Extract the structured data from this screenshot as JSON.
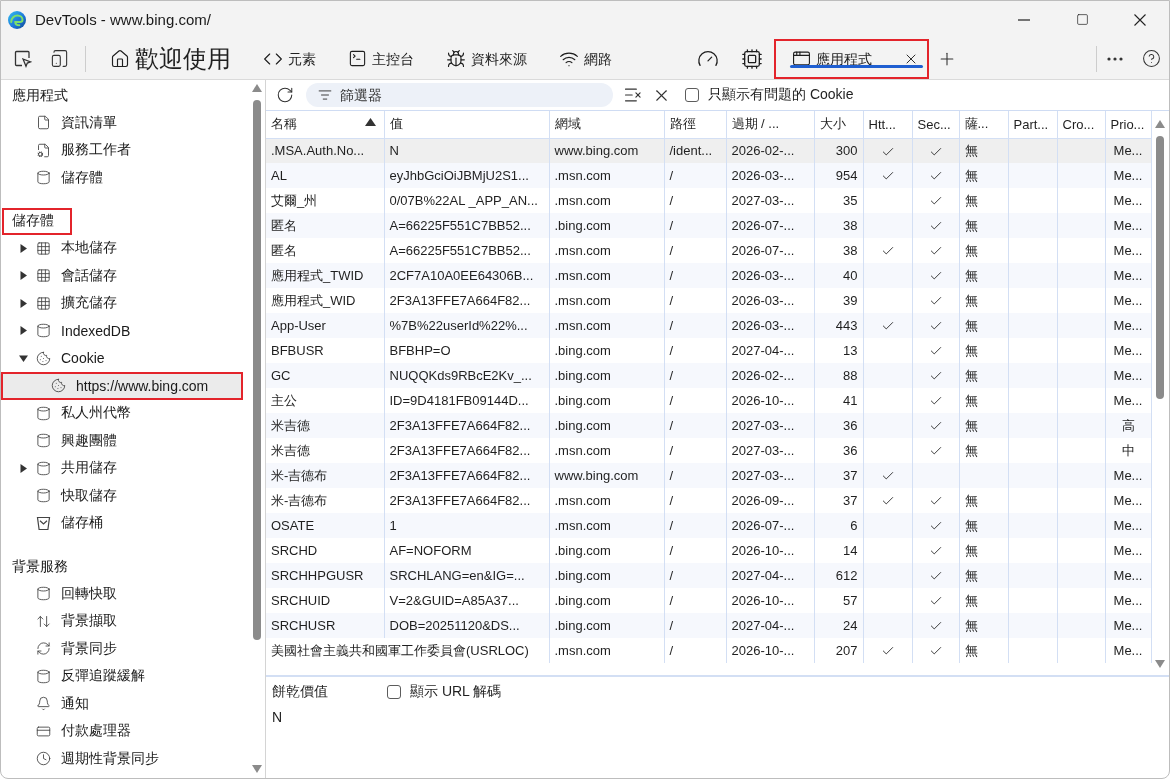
{
  "window": {
    "title": "DevTools - www.bing.com/"
  },
  "toolbar": {
    "tabs": [
      {
        "kind": "welcome",
        "label": "歡迎使用",
        "selected": false,
        "highlighted": false
      },
      {
        "kind": "elements",
        "label": "元素",
        "selected": false,
        "highlighted": false
      },
      {
        "kind": "console",
        "label": "主控台",
        "selected": false,
        "highlighted": false
      },
      {
        "kind": "sources",
        "label": "資料來源",
        "selected": false,
        "highlighted": false
      },
      {
        "kind": "network",
        "label": "網路",
        "selected": false,
        "highlighted": false
      },
      {
        "kind": "performance",
        "selected": false,
        "highlighted": false
      },
      {
        "kind": "memory",
        "selected": false,
        "highlighted": false
      },
      {
        "kind": "application",
        "label": "應用程式",
        "selected": true,
        "highlighted": true
      }
    ]
  },
  "sidebar": {
    "sections": [
      {
        "title": "應用程式",
        "highlighted": false,
        "items": [
          {
            "kind": "manifest",
            "label": "資訊清單",
            "selected": false,
            "highlighted": false
          },
          {
            "kind": "service-worker",
            "label": "服務工作者",
            "selected": false,
            "highlighted": false
          },
          {
            "kind": "database",
            "label": "儲存體",
            "selected": false,
            "highlighted": false
          }
        ]
      },
      {
        "title": "儲存體",
        "highlighted": true,
        "items": [
          {
            "kind": "table",
            "label": "本地儲存",
            "expanded": false,
            "selected": false,
            "highlighted": false
          },
          {
            "kind": "table",
            "label": "會話儲存",
            "expanded": false,
            "selected": false,
            "highlighted": false
          },
          {
            "kind": "table",
            "label": "擴充儲存",
            "expanded": false,
            "selected": false,
            "highlighted": false
          },
          {
            "kind": "database",
            "label": "IndexedDB",
            "expanded": false,
            "selected": false,
            "highlighted": false
          },
          {
            "kind": "cookie",
            "label": "Cookie",
            "expanded": true,
            "selected": false,
            "highlighted": false,
            "children": [
              {
                "kind": "cookie",
                "label": "https://www.bing.com",
                "selected": true,
                "highlighted": true
              }
            ]
          },
          {
            "kind": "database",
            "label": "私人州代幣",
            "selected": false,
            "highlighted": false
          },
          {
            "kind": "database",
            "label": "興趣團體",
            "selected": false,
            "highlighted": false
          },
          {
            "kind": "database",
            "label": "共用儲存",
            "expanded": false,
            "selected": false,
            "highlighted": false
          },
          {
            "kind": "database",
            "label": "快取儲存",
            "selected": false,
            "highlighted": false
          },
          {
            "kind": "bucket",
            "label": "儲存桶",
            "selected": false,
            "highlighted": false
          }
        ]
      },
      {
        "title": "背景服務",
        "highlighted": false,
        "items": [
          {
            "kind": "database",
            "label": "回轉快取",
            "selected": false,
            "highlighted": false
          },
          {
            "kind": "transfer",
            "label": "背景擷取",
            "selected": false,
            "highlighted": false
          },
          {
            "kind": "sync",
            "label": "背景同步",
            "selected": false,
            "highlighted": false
          },
          {
            "kind": "database",
            "label": "反彈追蹤緩解",
            "selected": false,
            "highlighted": false
          },
          {
            "kind": "bell",
            "label": "通知",
            "selected": false,
            "highlighted": false
          },
          {
            "kind": "card",
            "label": "付款處理器",
            "selected": false,
            "highlighted": false
          },
          {
            "kind": "clock",
            "label": "週期性背景同步",
            "selected": false,
            "highlighted": false
          }
        ]
      }
    ]
  },
  "cookies": {
    "filter": {
      "placeholder": "篩選器"
    },
    "only_issues": {
      "label": "只顯示有問題的 Cookie",
      "checked": false
    },
    "columns": [
      {
        "label": "名稱",
        "sorted": true
      },
      {
        "label": "值",
        "sorted": false
      },
      {
        "label": "網域",
        "sorted": false
      },
      {
        "label": "路徑",
        "sorted": false
      },
      {
        "label": "過期 / ...",
        "sorted": false
      },
      {
        "label": "大小",
        "sorted": false
      },
      {
        "label": "Htt...",
        "sorted": false
      },
      {
        "label": "Sec...",
        "sorted": false
      },
      {
        "label": "薩...",
        "sorted": false
      },
      {
        "label": "Part...",
        "sorted": false
      },
      {
        "label": "Cro...",
        "sorted": false
      },
      {
        "label": "Prio...",
        "sorted": false
      }
    ],
    "rows": [
      {
        "name": ".MSA.Auth.No...",
        "value": "N",
        "domain": "www.bing.com",
        "path": "/ident...",
        "expires": "2026-02-...",
        "size": "300",
        "http_only": true,
        "secure": true,
        "same_site": "無",
        "priority": "Me...",
        "selected": true
      },
      {
        "name": "AL",
        "value": "eyJhbGciOiJBMjU2S1...",
        "domain": ".msn.com",
        "path": "/",
        "expires": "2026-03-...",
        "size": "954",
        "http_only": true,
        "secure": true,
        "same_site": "無",
        "priority": "Me...",
        "selected": false
      },
      {
        "name": "艾爾_州",
        "value": "0/07B%22AL _APP_AN...",
        "domain": ".msn.com",
        "path": "/",
        "expires": "2027-03-...",
        "size": "35",
        "http_only": false,
        "secure": true,
        "same_site": "無",
        "priority": "Me...",
        "selected": false
      },
      {
        "name": "匿名",
        "value": "A=66225F551C7BB52...",
        "domain": ".bing.com",
        "path": "/",
        "expires": "2026-07-...",
        "size": "38",
        "http_only": false,
        "secure": true,
        "same_site": "無",
        "priority": "Me...",
        "selected": false
      },
      {
        "name": "匿名",
        "value": "A=66225F551C7BB52...",
        "domain": ".msn.com",
        "path": "/",
        "expires": "2026-07-...",
        "size": "38",
        "http_only": true,
        "secure": true,
        "same_site": "無",
        "priority": "Me...",
        "selected": false
      },
      {
        "name": "應用程式_TWID",
        "value": "2CF7A10A0EE64306B...",
        "domain": ".msn.com",
        "path": "/",
        "expires": "2026-03-...",
        "size": "40",
        "http_only": false,
        "secure": true,
        "same_site": "無",
        "priority": "Me...",
        "selected": false
      },
      {
        "name": "應用程式_WID",
        "value": "2F3A13FFE7A664F82...",
        "domain": ".msn.com",
        "path": "/",
        "expires": "2026-03-...",
        "size": "39",
        "http_only": false,
        "secure": true,
        "same_site": "無",
        "priority": "Me...",
        "selected": false
      },
      {
        "name": "App-User",
        "value": "%7B%22userId%22%...",
        "domain": ".msn.com",
        "path": "/",
        "expires": "2026-03-...",
        "size": "443",
        "http_only": true,
        "secure": true,
        "same_site": "無",
        "priority": "Me...",
        "selected": false
      },
      {
        "name": "BFBUSR",
        "value": "BFBHP=O",
        "domain": ".bing.com",
        "path": "/",
        "expires": "2027-04-...",
        "size": "13",
        "http_only": false,
        "secure": true,
        "same_site": "無",
        "priority": "Me...",
        "selected": false
      },
      {
        "name": "GC",
        "value": "NUQQKds9RBcE2Kv_...",
        "domain": ".bing.com",
        "path": "/",
        "expires": "2026-02-...",
        "size": "88",
        "http_only": false,
        "secure": true,
        "same_site": "無",
        "priority": "Me...",
        "selected": false
      },
      {
        "name": "主公",
        "value": "ID=9D4181FB09144D...",
        "domain": ".bing.com",
        "path": "/",
        "expires": "2026-10-...",
        "size": "41",
        "http_only": false,
        "secure": true,
        "same_site": "無",
        "priority": "Me...",
        "selected": false
      },
      {
        "name": "米吉德",
        "value": "2F3A13FFE7A664F82...",
        "domain": ".bing.com",
        "path": "/",
        "expires": "2027-03-...",
        "size": "36",
        "http_only": false,
        "secure": true,
        "same_site": "無",
        "priority": "高",
        "selected": false
      },
      {
        "name": "米吉德",
        "value": "2F3A13FFE7A664F82...",
        "domain": ".msn.com",
        "path": "/",
        "expires": "2027-03-...",
        "size": "36",
        "http_only": false,
        "secure": true,
        "same_site": "無",
        "priority": "中",
        "selected": false
      },
      {
        "name": "米-吉德布",
        "value": "2F3A13FFE7A664F82...",
        "domain": "www.bing.com",
        "path": "/",
        "expires": "2027-03-...",
        "size": "37",
        "http_only": true,
        "secure": false,
        "priority": "Me...",
        "selected": false
      },
      {
        "name": "米-吉德布",
        "value": "2F3A13FFE7A664F82...",
        "domain": ".msn.com",
        "path": "/",
        "expires": "2026-09-...",
        "size": "37",
        "http_only": true,
        "secure": true,
        "same_site": "無",
        "priority": "Me...",
        "selected": false
      },
      {
        "name": "OSATE",
        "value": "1",
        "domain": ".msn.com",
        "path": "/",
        "expires": "2026-07-...",
        "size": "6",
        "http_only": false,
        "secure": true,
        "same_site": "無",
        "priority": "Me...",
        "selected": false
      },
      {
        "name": "SRCHD",
        "value": "AF=NOFORM",
        "domain": ".bing.com",
        "path": "/",
        "expires": "2026-10-...",
        "size": "14",
        "http_only": false,
        "secure": true,
        "same_site": "無",
        "priority": "Me...",
        "selected": false
      },
      {
        "name": "SRCHHPGUSR",
        "value": "SRCHLANG=en&IG=...",
        "domain": ".bing.com",
        "path": "/",
        "expires": "2027-04-...",
        "size": "612",
        "http_only": false,
        "secure": true,
        "same_site": "無",
        "priority": "Me...",
        "selected": false
      },
      {
        "name": "SRCHUID",
        "value": "V=2&GUID=A85A37...",
        "domain": ".bing.com",
        "path": "/",
        "expires": "2026-10-...",
        "size": "57",
        "http_only": false,
        "secure": true,
        "same_site": "無",
        "priority": "Me...",
        "selected": false
      },
      {
        "name": "SRCHUSR",
        "value": "DOB=20251120&DS...",
        "domain": ".bing.com",
        "path": "/",
        "expires": "2027-04-...",
        "size": "24",
        "http_only": false,
        "secure": true,
        "same_site": "無",
        "priority": "Me...",
        "selected": false
      },
      {
        "name": "美國社會主義共和國軍工作委員會(USRLOC)",
        "domain": ".msn.com",
        "path": "/",
        "expires": "2026-10-...",
        "size": "207",
        "http_only": true,
        "secure": true,
        "same_site": "無",
        "priority": "Me...",
        "selected": false
      }
    ]
  },
  "cookie_value": {
    "title": "餅乾價值",
    "show_url_decoded": {
      "label": "顯示 URL 解碼",
      "checked": false
    },
    "value": "N"
  }
}
